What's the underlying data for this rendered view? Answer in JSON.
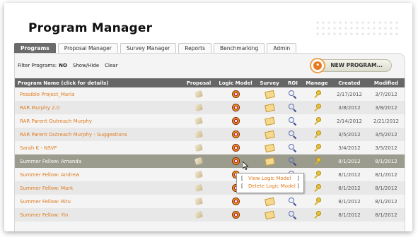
{
  "page": {
    "title": "Program Manager"
  },
  "tabs": [
    {
      "label": "Programs",
      "active": true
    },
    {
      "label": "Proposal Manager",
      "active": false
    },
    {
      "label": "Survey Manager",
      "active": false
    },
    {
      "label": "Reports",
      "active": false
    },
    {
      "label": "Benchmarking",
      "active": false
    },
    {
      "label": "Admin",
      "active": false
    }
  ],
  "filter": {
    "label": "Filter Programs:",
    "value": "NO",
    "show_hide": "Show/Hide",
    "clear": "Clear"
  },
  "new_program_button": {
    "label": "NEW PROGRAM..."
  },
  "table": {
    "columns": [
      "Program Name (click for details)",
      "Proposal",
      "Logic Model",
      "Survey",
      "ROI",
      "Manage",
      "Created",
      "Modified"
    ],
    "rows": [
      {
        "name": "Possible Project_Maria",
        "created": "2/17/2012",
        "modified": "3/7/2012",
        "survey": true
      },
      {
        "name": "RAR Murphy 2.0",
        "created": "3/8/2012",
        "modified": "3/8/2012",
        "survey": true
      },
      {
        "name": "RAR Parent Outreach Murphy",
        "created": "2/14/2012",
        "modified": "2/21/2012",
        "survey": true
      },
      {
        "name": "RAR Parent Outreach Murphy - Suggestions",
        "created": "3/5/2012",
        "modified": "3/5/2012",
        "survey": true
      },
      {
        "name": "Sarah K - NSVF",
        "created": "3/4/2012",
        "modified": "3/5/2012",
        "survey": true
      },
      {
        "name": "Summer Fellow: Amanda",
        "created": "8/1/2012",
        "modified": "8/1/2012",
        "survey": true,
        "highlight": true
      },
      {
        "name": "Summer Fellow: Andrew",
        "created": "8/1/2012",
        "modified": "8/1/2012",
        "survey": false
      },
      {
        "name": "Summer Fellow: Mark",
        "created": "8/1/2012",
        "modified": "8/1/2012",
        "survey": false
      },
      {
        "name": "Summer Fellow: Ritu",
        "created": "8/1/2012",
        "modified": "8/1/2012",
        "survey": true
      },
      {
        "name": "Summer Fellow: Yin",
        "created": "8/1/2012",
        "modified": "8/1/2012",
        "survey": true
      }
    ]
  },
  "logic_model_popup": {
    "bracket_open": "[",
    "bracket_close": "]",
    "items": [
      "View Logic Model",
      "Delete Logic Model"
    ]
  },
  "icons": {
    "proposal": "proposal-document-icon",
    "logic_model": "logic-model-target-icon",
    "survey": "survey-envelope-icon",
    "roi": "magnifier-icon",
    "manage": "key-icon"
  },
  "colors": {
    "accent": "#e07a1e",
    "header": "#666666",
    "highlight_row": "#9b9b8e"
  }
}
